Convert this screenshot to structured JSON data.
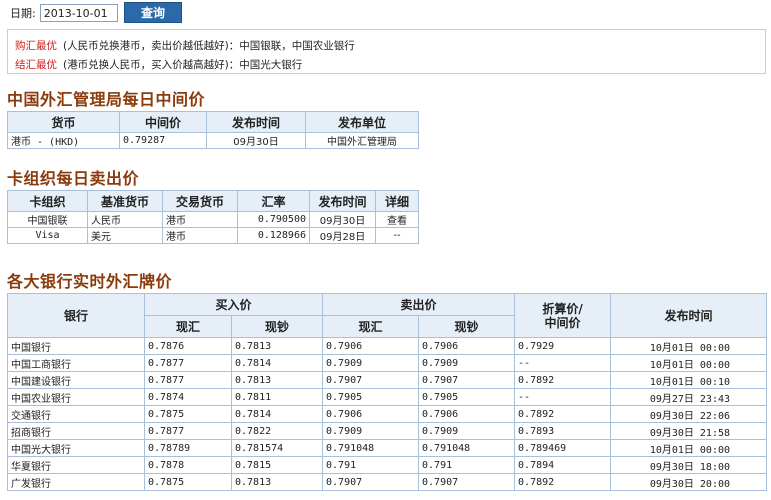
{
  "search": {
    "date_label": "日期:",
    "date_value": "2013-10-01",
    "query_label": "查询"
  },
  "info": {
    "buy_best_tag": "购汇最优",
    "buy_best_text": "(人民币兑换港币，卖出价越低越好)：中国银联，中国农业银行",
    "sell_best_tag": "结汇最优",
    "sell_best_text": "(港币兑换人民币，买入价越高越好)：中国光大银行"
  },
  "section1": {
    "title": "中国外汇管理局每日中间价",
    "headers": [
      "货币",
      "中间价",
      "发布时间",
      "发布单位"
    ],
    "rows": [
      [
        "港币 - (HKD)",
        "0.79287",
        "09月30日",
        "中国外汇管理局"
      ]
    ]
  },
  "section2": {
    "title": "卡组织每日卖出价",
    "headers": [
      "卡组织",
      "基准货币",
      "交易货币",
      "汇率",
      "发布时间",
      "详细"
    ],
    "rows": [
      [
        "中国银联",
        "人民币",
        "港币",
        "0.790500",
        "09月30日",
        "查看"
      ],
      [
        "Visa",
        "美元",
        "港币",
        "0.128966",
        "09月28日",
        "--"
      ]
    ]
  },
  "section3": {
    "title": "各大银行实时外汇牌价",
    "h_bank": "银行",
    "h_buy": "买入价",
    "h_sell": "卖出价",
    "h_mid": "折算价/\n中间价",
    "h_time": "发布时间",
    "h_spot": "现汇",
    "h_cash": "现钞",
    "rows": [
      [
        "中国银行",
        "0.7876",
        "0.7813",
        "0.7906",
        "0.7906",
        "0.7929",
        "10月01日 00:00"
      ],
      [
        "中国工商银行",
        "0.7877",
        "0.7814",
        "0.7909",
        "0.7909",
        "--",
        "10月01日 00:00"
      ],
      [
        "中国建设银行",
        "0.7877",
        "0.7813",
        "0.7907",
        "0.7907",
        "0.7892",
        "10月01日 00:10"
      ],
      [
        "中国农业银行",
        "0.7874",
        "0.7811",
        "0.7905",
        "0.7905",
        "--",
        "09月27日 23:43"
      ],
      [
        "交通银行",
        "0.7875",
        "0.7814",
        "0.7906",
        "0.7906",
        "0.7892",
        "09月30日 22:06"
      ],
      [
        "招商银行",
        "0.7877",
        "0.7822",
        "0.7909",
        "0.7909",
        "0.7893",
        "09月30日 21:58"
      ],
      [
        "中国光大银行",
        "0.78789",
        "0.781574",
        "0.791048",
        "0.791048",
        "0.789469",
        "10月01日 00:00"
      ],
      [
        "华夏银行",
        "0.7878",
        "0.7815",
        "0.791",
        "0.791",
        "0.7894",
        "09月30日 18:00"
      ],
      [
        "广发银行",
        "0.7875",
        "0.7813",
        "0.7907",
        "0.7907",
        "0.7892",
        "09月30日 20:00"
      ]
    ]
  }
}
